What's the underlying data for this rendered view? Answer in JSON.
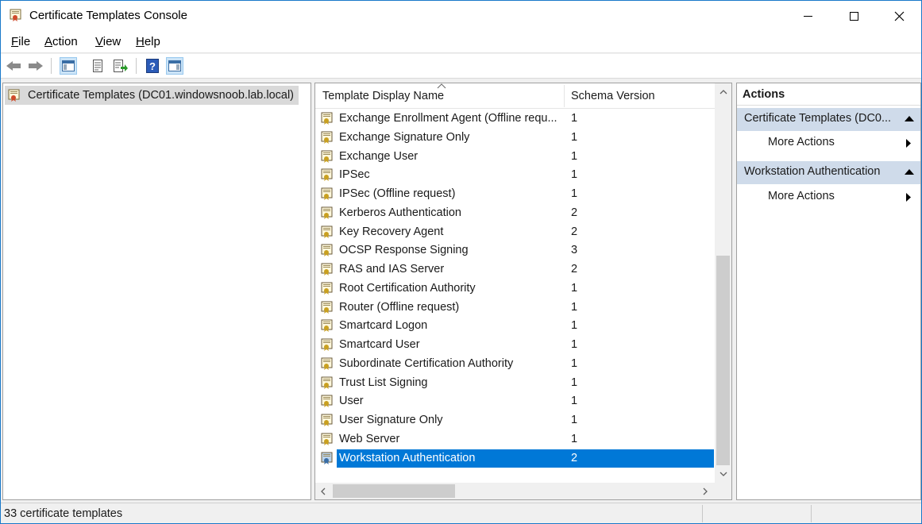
{
  "window": {
    "title": "Certificate Templates Console"
  },
  "menu": [
    "File",
    "Action",
    "View",
    "Help"
  ],
  "toolbar": {
    "buttons": [
      "back-icon",
      "forward-icon",
      "show-hide-tree-icon",
      "properties-icon",
      "export-list-icon",
      "help-icon",
      "show-hide-action-pane-icon"
    ]
  },
  "tree": {
    "root_label": "Certificate Templates (DC01.windowsnoob.lab.local)"
  },
  "list": {
    "columns": [
      "Template Display Name",
      "Schema Version"
    ],
    "sort_column": "Template Display Name",
    "rows": [
      {
        "name": "Exchange Enrollment Agent (Offline requ...",
        "version": "1"
      },
      {
        "name": "Exchange Signature Only",
        "version": "1"
      },
      {
        "name": "Exchange User",
        "version": "1"
      },
      {
        "name": "IPSec",
        "version": "1"
      },
      {
        "name": "IPSec (Offline request)",
        "version": "1"
      },
      {
        "name": "Kerberos Authentication",
        "version": "2"
      },
      {
        "name": "Key Recovery Agent",
        "version": "2"
      },
      {
        "name": "OCSP Response Signing",
        "version": "3"
      },
      {
        "name": "RAS and IAS Server",
        "version": "2"
      },
      {
        "name": "Root Certification Authority",
        "version": "1"
      },
      {
        "name": "Router (Offline request)",
        "version": "1"
      },
      {
        "name": "Smartcard Logon",
        "version": "1"
      },
      {
        "name": "Smartcard User",
        "version": "1"
      },
      {
        "name": "Subordinate Certification Authority",
        "version": "1"
      },
      {
        "name": "Trust List Signing",
        "version": "1"
      },
      {
        "name": "User",
        "version": "1"
      },
      {
        "name": "User Signature Only",
        "version": "1"
      },
      {
        "name": "Web Server",
        "version": "1"
      },
      {
        "name": "Workstation Authentication",
        "version": "2"
      }
    ],
    "selected_row": "Workstation Authentication"
  },
  "actions": {
    "title": "Actions",
    "sections": [
      {
        "label": "Certificate Templates (DC0...",
        "item": "More Actions"
      },
      {
        "label": "Workstation Authentication",
        "item": "More Actions"
      }
    ]
  },
  "status": {
    "text": "33 certificate templates"
  },
  "colors": {
    "selection": "#0078d7",
    "action_header": "#cfdbea",
    "border": "#1979ca"
  }
}
